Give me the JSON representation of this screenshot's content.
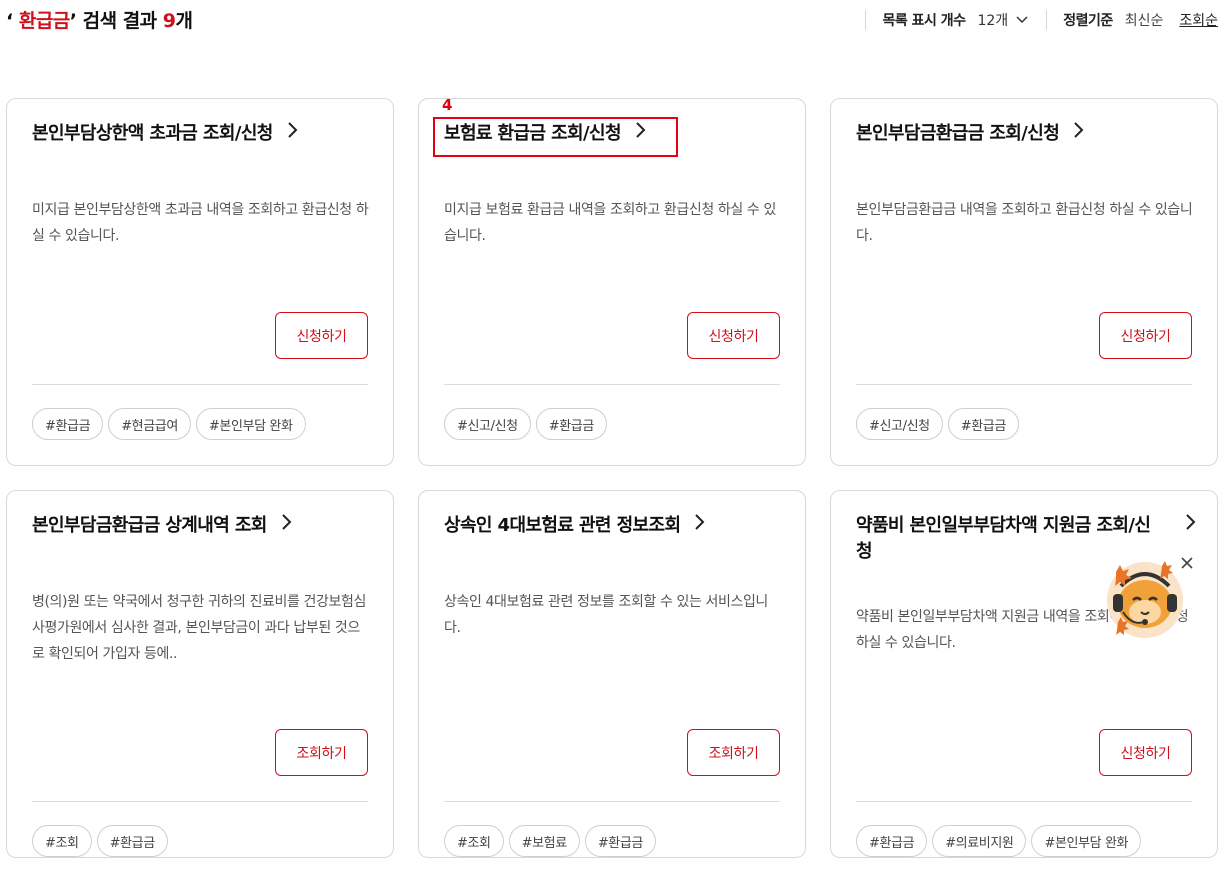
{
  "header": {
    "quote_open": "‘ ",
    "keyword": "환급금",
    "quote_close": "’",
    "result_text": " 검색 결과 ",
    "count": "9",
    "count_unit": "개"
  },
  "controls": {
    "per_page_label": "목록 표시 개수",
    "per_page_value": "12개",
    "sort_label": "정렬기준",
    "sort_options": [
      "최신순",
      "조회순"
    ]
  },
  "annotation": {
    "number": "4"
  },
  "cards": [
    {
      "title": "본인부담상한액 초과금 조회/신청",
      "description": "미지급 본인부담상한액 초과금 내역을 조회하고 환급신청 하실 수 있습니다.",
      "button": "신청하기",
      "tags": [
        "#환급금",
        "#현금급여",
        "#본인부담 완화"
      ]
    },
    {
      "title": "보험료 환급금 조회/신청",
      "description": "미지급 보험료 환급금 내역을 조회하고 환급신청 하실 수 있습니다.",
      "button": "신청하기",
      "tags": [
        "#신고/신청",
        "#환급금"
      ]
    },
    {
      "title": "본인부담금환급금 조회/신청",
      "description": "본인부담금환급금 내역을 조회하고 환급신청 하실 수 있습니다.",
      "button": "신청하기",
      "tags": [
        "#신고/신청",
        "#환급금"
      ]
    },
    {
      "title": "본인부담금환급금 상계내역 조회",
      "description": "병(의)원 또는 약국에서 청구한 귀하의 진료비를 건강보험심사평가원에서 심사한 결과, 본인부담금이 과다 납부된 것으로 확인되어 가입자 등에..",
      "button": "조회하기",
      "tags": [
        "#조회",
        "#환급금"
      ]
    },
    {
      "title": "상속인 4대보험료 관련 정보조회",
      "description": "상속인 4대보험료 관련 정보를 조회할 수 있는 서비스입니다.",
      "button": "조회하기",
      "tags": [
        "#조회",
        "#보험료",
        "#환급금"
      ]
    },
    {
      "title": "약품비 본인일부부담차액 지원금 조회/신청",
      "description": "약품비 본인일부부담차액 지원금 내역을 조회하고 환급신청 하실 수 있습니다.",
      "button": "신청하기",
      "tags": [
        "#환급금",
        "#의료비지원",
        "#본인부담 완화"
      ]
    }
  ],
  "icons": {
    "title_arrow": "chevron-right-icon",
    "per_page_arrow": "chevron-down-icon",
    "mascot": "mascot-character-icon",
    "close": "close-icon"
  },
  "colors": {
    "accent": "#d0101b",
    "highlight": "#e3000f",
    "card_border": "#d8d8d8"
  }
}
